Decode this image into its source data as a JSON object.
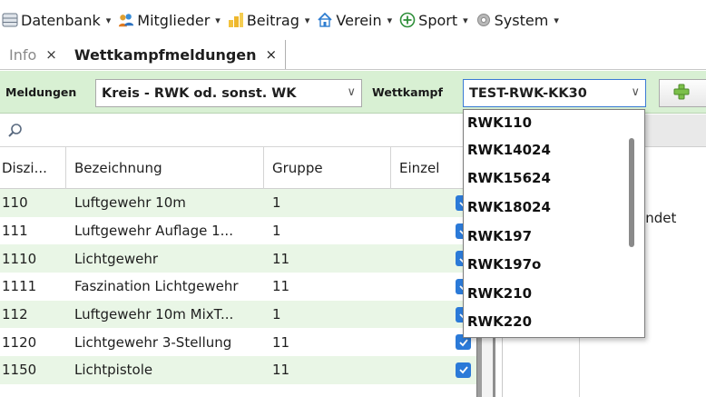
{
  "menubar": {
    "items": [
      {
        "label": "Datenbank",
        "icon": "database-icon"
      },
      {
        "label": "Mitglieder",
        "icon": "members-icon"
      },
      {
        "label": "Beitrag",
        "icon": "coins-icon"
      },
      {
        "label": "Verein",
        "icon": "house-icon"
      },
      {
        "label": "Sport",
        "icon": "plus-circle-icon"
      },
      {
        "label": "System",
        "icon": "gear-icon"
      }
    ],
    "caret": "▾"
  },
  "tabs": [
    {
      "label": "Info",
      "close": "×",
      "active": false
    },
    {
      "label": "Wettkampfmeldungen",
      "close": "×",
      "active": true
    }
  ],
  "toolbar": {
    "meldungen_label": "Meldungen",
    "meldungen_value": "Kreis - RWK od. sonst. WK",
    "wettkampf_label": "Wettkampf",
    "wettkampf_value": "TEST-RWK-KK30",
    "chevron": "∨"
  },
  "grid": {
    "columns": [
      "Diszi...",
      "Bezeichnung",
      "Gruppe",
      "Einzel"
    ],
    "rows": [
      {
        "diszi": "110",
        "bezeichnung": "Luftgewehr 10m",
        "gruppe": "1",
        "einzel": true
      },
      {
        "diszi": "111",
        "bezeichnung": "Luftgewehr Auflage 1...",
        "gruppe": "1",
        "einzel": true
      },
      {
        "diszi": "1110",
        "bezeichnung": "Lichtgewehr",
        "gruppe": "11",
        "einzel": true
      },
      {
        "diszi": "1111",
        "bezeichnung": "Faszination Lichtgewehr",
        "gruppe": "11",
        "einzel": true
      },
      {
        "diszi": "112",
        "bezeichnung": "Luftgewehr 10m MixT...",
        "gruppe": "1",
        "einzel": true
      },
      {
        "diszi": "1120",
        "bezeichnung": "Lichtgewehr 3-Stellung",
        "gruppe": "11",
        "einzel": true
      },
      {
        "diszi": "1150",
        "bezeichnung": "Lichtpistole",
        "gruppe": "11",
        "einzel": true
      }
    ]
  },
  "right_panel": {
    "partial_text": "endet"
  },
  "dropdown": {
    "options": [
      "RWK110",
      "RWK14024",
      "RWK15624",
      "RWK18024",
      "RWK197",
      "RWK197o",
      "RWK210",
      "RWK220"
    ]
  },
  "colors": {
    "toolbar_bg": "#d8f0d3",
    "row_alt": "#e9f6e6",
    "checkbox": "#2b7ad8",
    "focus_border": "#3b7ad4"
  }
}
